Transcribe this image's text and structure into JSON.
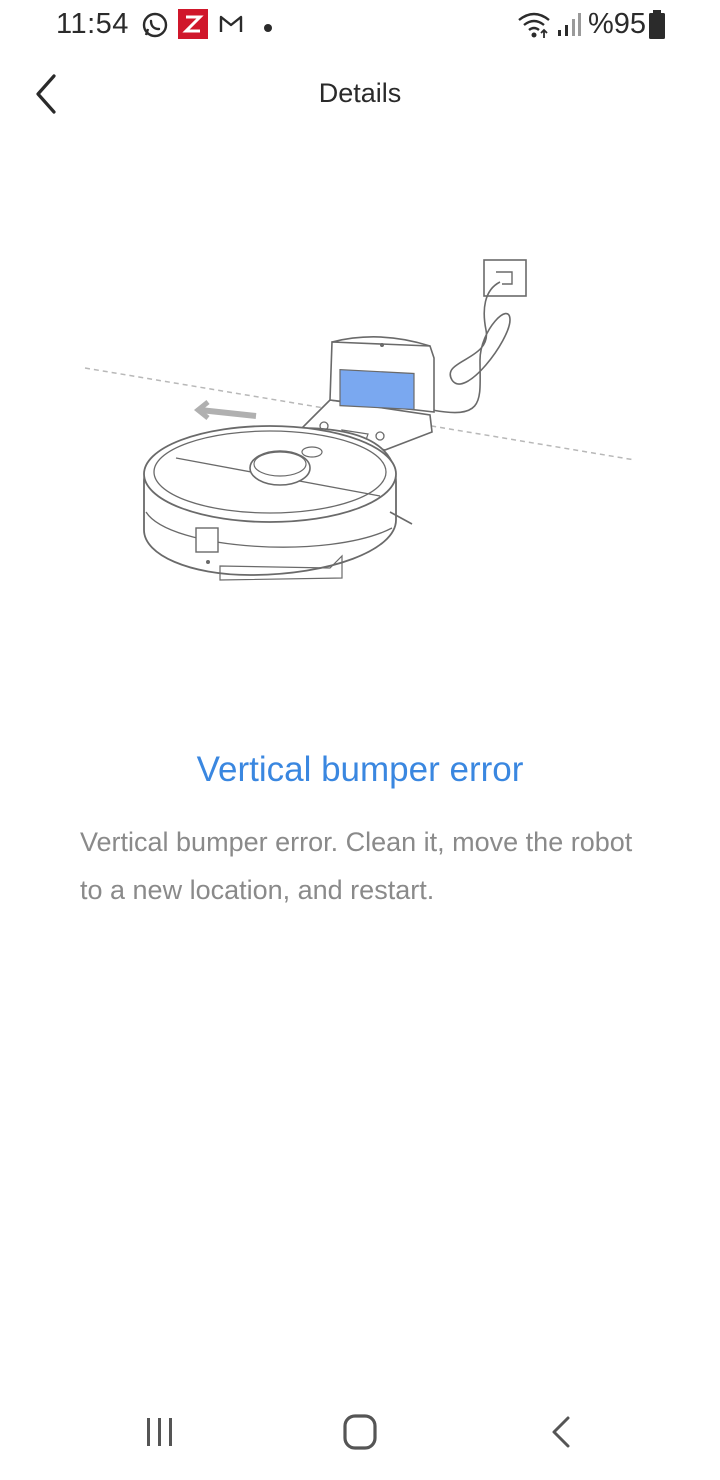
{
  "status_bar": {
    "time": "11:54",
    "battery_text": "%95",
    "icons": [
      "whatsapp-icon",
      "zoom-app-icon",
      "gmail-icon",
      "notification-dot-icon",
      "wifi-icon",
      "signal-icon",
      "battery-icon"
    ],
    "colors": {
      "zoom_app_bg": "#d0172b"
    }
  },
  "app_bar": {
    "title": "Details",
    "back_icon": "chevron-left-icon"
  },
  "content": {
    "illustration": "robot-vacuum-dock-illustration",
    "error_title": "Vertical bumper error",
    "error_description": "Vertical bumper error. Clean it, move the robot to a new location, and restart.",
    "colors": {
      "title": "#3a87e0",
      "description": "#8a8a8a",
      "dock_screen": "#7aa8f0"
    }
  },
  "nav_bar": {
    "icons": [
      "recent-apps-icon",
      "home-icon",
      "back-icon"
    ]
  }
}
